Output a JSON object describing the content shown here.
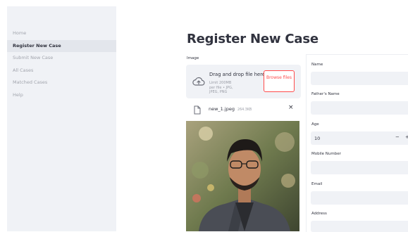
{
  "sidebar": {
    "items": [
      {
        "label": "Home"
      },
      {
        "label": "Register New Case"
      },
      {
        "label": "Submit New Case"
      },
      {
        "label": "All Cases"
      },
      {
        "label": "Matched Cases"
      },
      {
        "label": "Help"
      }
    ],
    "active_index": 1
  },
  "page": {
    "title": "Register New Case"
  },
  "uploader": {
    "label": "Image",
    "drop_title": "Drag and drop file here",
    "hint": "Limit 200MB per file • JPG, JPEG, PNG",
    "browse_label": "Browse files",
    "icon": "cloud-upload-icon"
  },
  "file": {
    "name": "new_1.jpeg",
    "size": "264.3KB",
    "icon": "file-icon",
    "remove_label": "×"
  },
  "form": {
    "name_label": "Name",
    "father_label": "Father's Name",
    "age_label": "Age",
    "age_value": "10",
    "minus": "−",
    "plus": "+",
    "mobile_label": "Mobile Number",
    "email_label": "Email",
    "address_label": "Address"
  },
  "colors": {
    "accent": "#ff4b4b",
    "sidebar_bg": "#f0f2f6",
    "input_bg": "#f0f2f6",
    "text": "#31333f",
    "muted": "#a2a5ad"
  }
}
